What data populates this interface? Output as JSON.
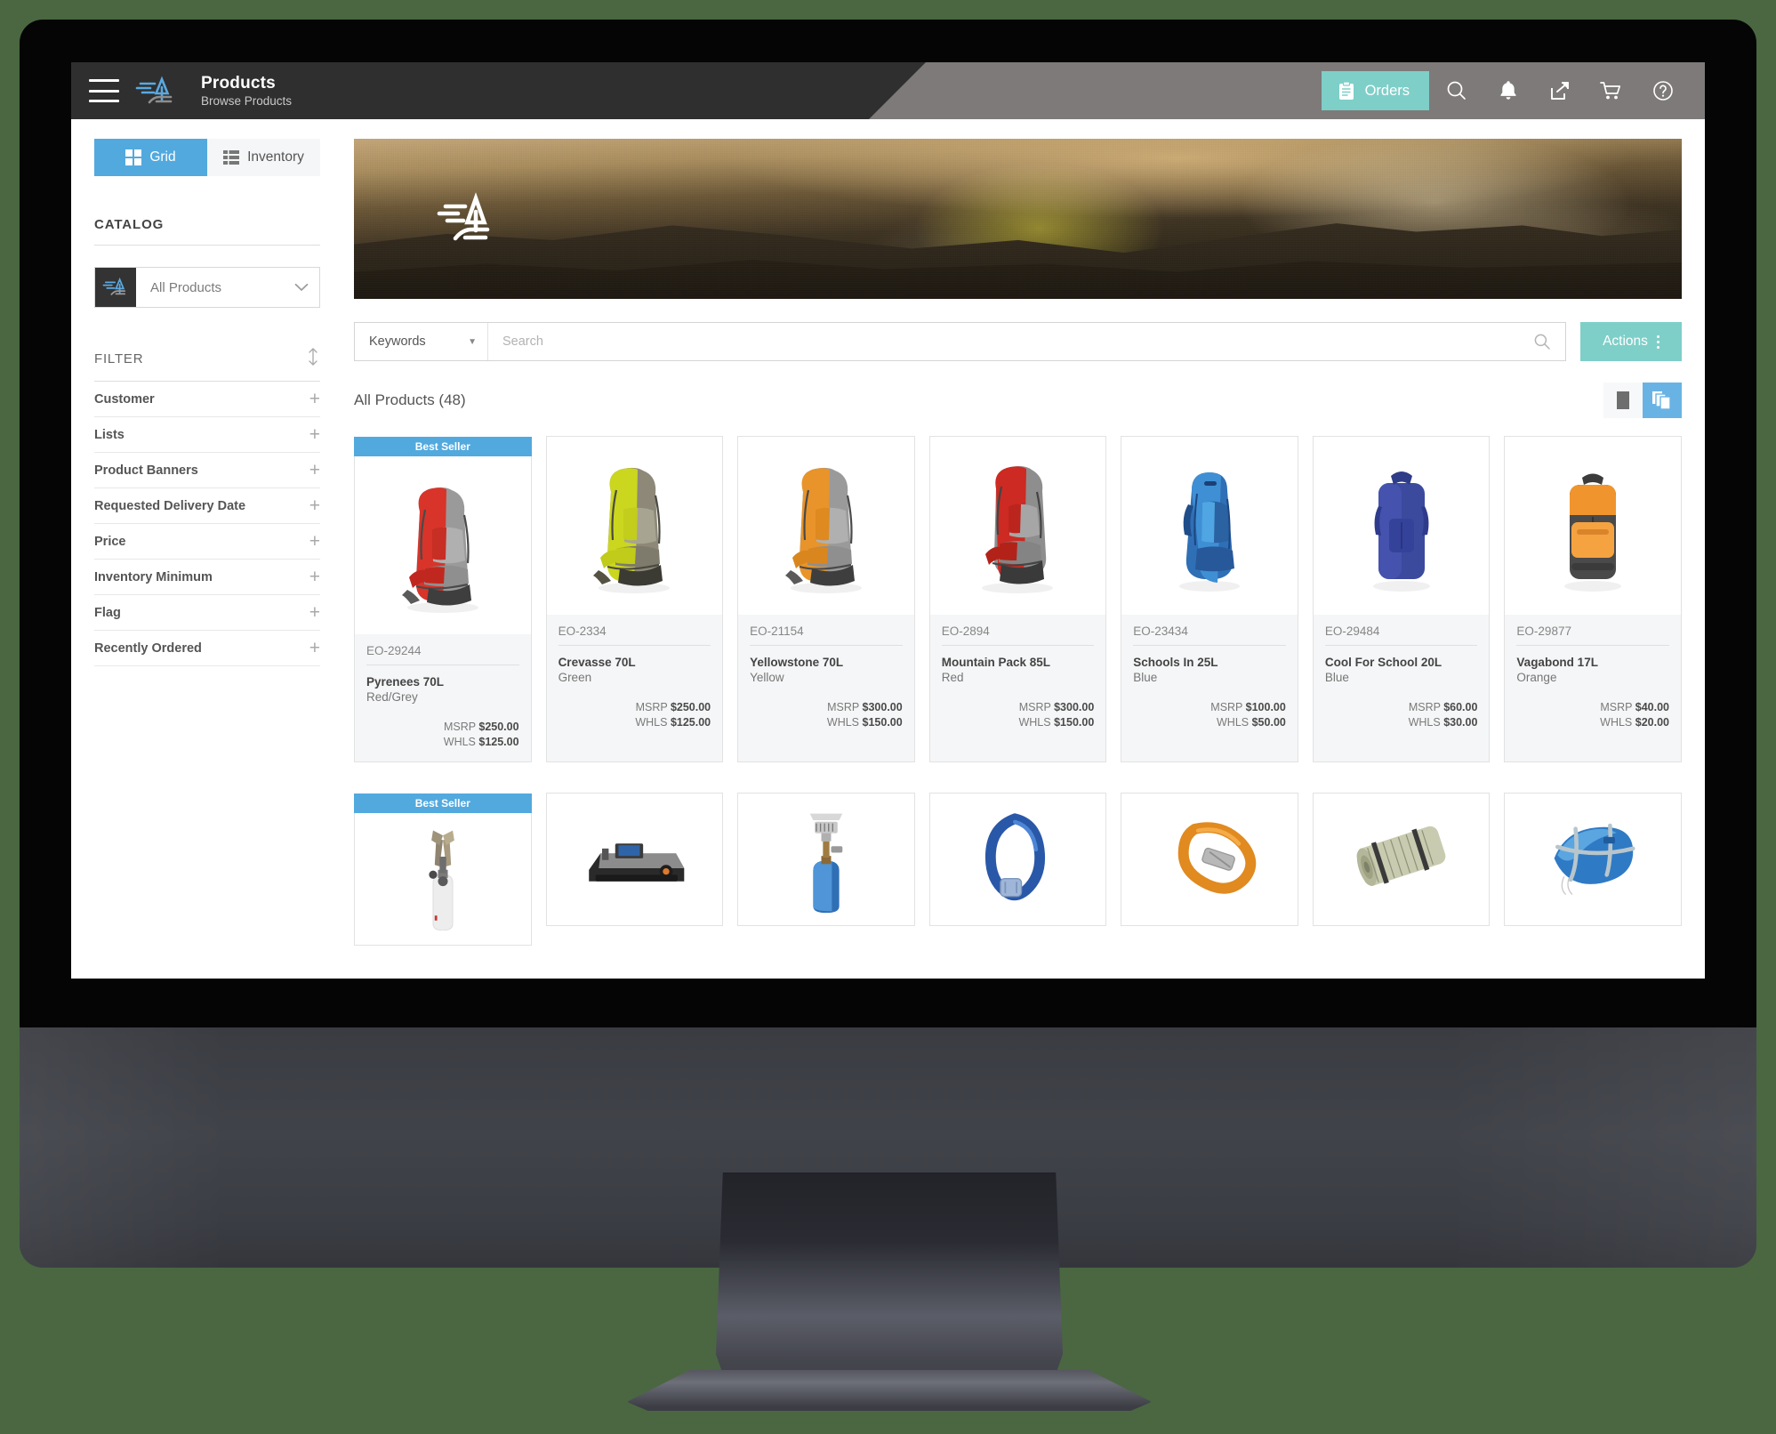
{
  "header": {
    "title": "Products",
    "subtitle": "Browse Products",
    "menu_icon": "hamburger-icon",
    "logo_icon": "brand-logo-icon",
    "orders_label": "Orders",
    "orders_icon": "clipboard-icon",
    "icons": [
      "search-icon",
      "bell-icon",
      "share-icon",
      "cart-icon",
      "help-icon"
    ],
    "accent_teal": "#7ecfc8",
    "bar_dark": "#2f2f2f",
    "bar_light": "#7d7a79"
  },
  "sidebar": {
    "view_tabs": [
      {
        "label": "Grid",
        "icon": "grid-icon",
        "active": true
      },
      {
        "label": "Inventory",
        "icon": "list-icon",
        "active": false
      }
    ],
    "catalog_heading": "CATALOG",
    "catalog_select": {
      "value": "All Products",
      "icon": "brand-logo-icon",
      "caret": "chevron-down-icon"
    },
    "filter_heading": "FILTER",
    "filter_sort_icon": "sort-updown-icon",
    "filters": [
      {
        "label": "Customer"
      },
      {
        "label": "Lists"
      },
      {
        "label": "Product Banners"
      },
      {
        "label": "Requested Delivery Date"
      },
      {
        "label": "Price"
      },
      {
        "label": "Inventory Minimum"
      },
      {
        "label": "Flag"
      },
      {
        "label": "Recently Ordered"
      }
    ],
    "expand_glyph": "+"
  },
  "search": {
    "scope_label": "Keywords",
    "scope_caret": "chevron-down-icon",
    "placeholder": "Search",
    "value": "",
    "search_icon": "search-icon",
    "actions_label": "Actions",
    "actions_icon": "kebab-menu-icon"
  },
  "results": {
    "title": "All Products (48)",
    "count": 48,
    "view_buttons": [
      {
        "icon": "single-card-view-icon",
        "active": false
      },
      {
        "icon": "multi-card-view-icon",
        "active": true
      }
    ]
  },
  "badges": {
    "best_seller": "Best Seller",
    "badge_color": "#52a9de"
  },
  "price_labels": {
    "msrp": "MSRP",
    "whls": "WHLS"
  },
  "products": [
    {
      "sku": "EO-29244",
      "name": "Pyrenees 70L",
      "color": "Red/Grey",
      "msrp": "$250.00",
      "whls": "$125.00",
      "badge": "Best Seller",
      "img": "backpack-red-grey"
    },
    {
      "sku": "EO-2334",
      "name": "Crevasse 70L",
      "color": "Green",
      "msrp": "$250.00",
      "whls": "$125.00",
      "badge": "",
      "img": "backpack-green"
    },
    {
      "sku": "EO-21154",
      "name": "Yellowstone 70L",
      "color": "Yellow",
      "msrp": "$300.00",
      "whls": "$150.00",
      "badge": "",
      "img": "backpack-orange"
    },
    {
      "sku": "EO-2894",
      "name": "Mountain Pack 85L",
      "color": "Red",
      "msrp": "$300.00",
      "whls": "$150.00",
      "badge": "",
      "img": "backpack-red"
    },
    {
      "sku": "EO-23434",
      "name": "Schools In 25L",
      "color": "Blue",
      "msrp": "$100.00",
      "whls": "$50.00",
      "badge": "",
      "img": "daypack-blue"
    },
    {
      "sku": "EO-29484",
      "name": "Cool For School 20L",
      "color": "Blue",
      "msrp": "$60.00",
      "whls": "$30.00",
      "badge": "",
      "img": "daypack-navy"
    },
    {
      "sku": "EO-29877",
      "name": "Vagabond 17L",
      "color": "Orange",
      "msrp": "$40.00",
      "whls": "$20.00",
      "badge": "",
      "img": "daypack-orange"
    }
  ],
  "products_row2": [
    {
      "badge": "Best Seller",
      "img": "camp-stove-canister"
    },
    {
      "badge": "",
      "img": "portable-gas-stove"
    },
    {
      "badge": "",
      "img": "burner-blue-canister"
    },
    {
      "badge": "",
      "img": "carabiner-blue"
    },
    {
      "badge": "",
      "img": "carabiner-orange"
    },
    {
      "badge": "",
      "img": "sleeping-mat-rolled"
    },
    {
      "badge": "",
      "img": "sleeping-bag-blue"
    }
  ]
}
